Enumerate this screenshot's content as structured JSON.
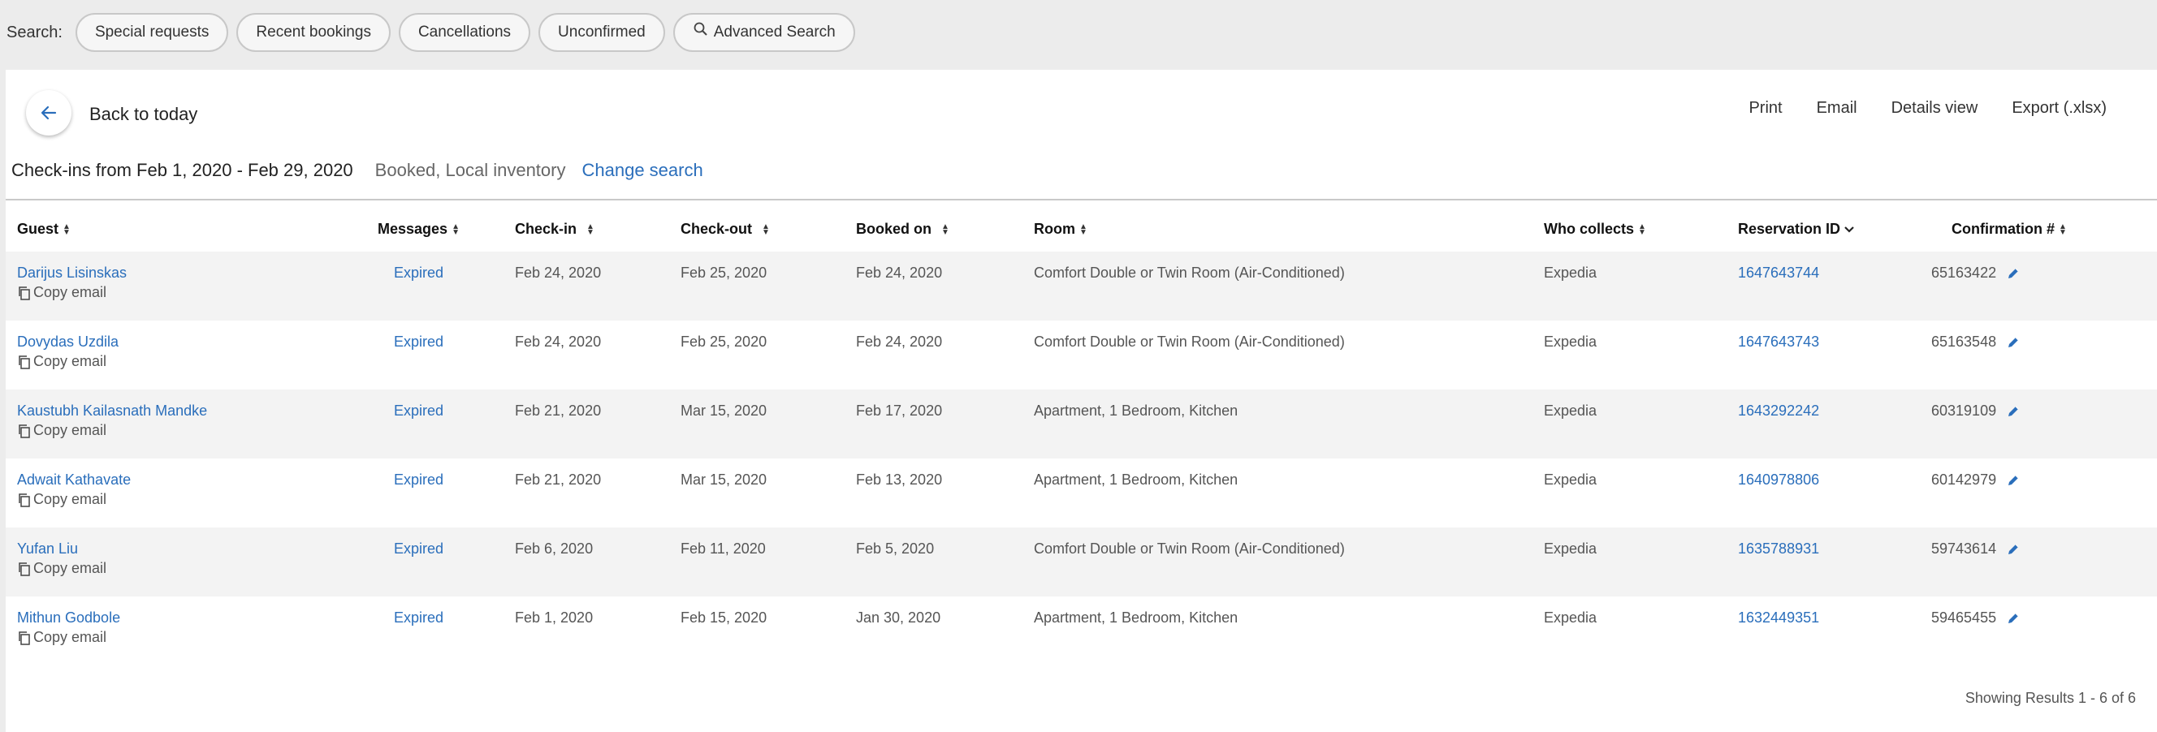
{
  "search": {
    "label": "Search:",
    "pills": [
      "Special requests",
      "Recent bookings",
      "Cancellations",
      "Unconfirmed",
      "Advanced Search"
    ]
  },
  "header": {
    "back_label": "Back to today",
    "actions": [
      "Print",
      "Email",
      "Details view",
      "Export (.xlsx)"
    ]
  },
  "filter": {
    "range": "Check-ins from Feb 1, 2020 - Feb 29, 2020",
    "filters": "Booked, Local inventory",
    "change": "Change search"
  },
  "table": {
    "columns": [
      "Guest",
      "Messages",
      "Check-in",
      "Check-out",
      "Booked on",
      "Room",
      "Who collects",
      "Reservation ID",
      "Confirmation #"
    ],
    "copy_label": "Copy email",
    "rows": [
      {
        "guest": "Darijus Lisinskas",
        "messages": "Expired",
        "checkin": "Feb 24, 2020",
        "checkout": "Feb 25, 2020",
        "booked": "Feb 24, 2020",
        "room": "Comfort Double or Twin Room (Air-Conditioned)",
        "collects": "Expedia",
        "reservation": "1647643744",
        "confirmation": "65163422"
      },
      {
        "guest": "Dovydas Uzdila",
        "messages": "Expired",
        "checkin": "Feb 24, 2020",
        "checkout": "Feb 25, 2020",
        "booked": "Feb 24, 2020",
        "room": "Comfort Double or Twin Room (Air-Conditioned)",
        "collects": "Expedia",
        "reservation": "1647643743",
        "confirmation": "65163548"
      },
      {
        "guest": "Kaustubh Kailasnath Mandke",
        "messages": "Expired",
        "checkin": "Feb 21, 2020",
        "checkout": "Mar 15, 2020",
        "booked": "Feb 17, 2020",
        "room": "Apartment, 1 Bedroom, Kitchen",
        "collects": "Expedia",
        "reservation": "1643292242",
        "confirmation": "60319109"
      },
      {
        "guest": "Adwait Kathavate",
        "messages": "Expired",
        "checkin": "Feb 21, 2020",
        "checkout": "Mar 15, 2020",
        "booked": "Feb 13, 2020",
        "room": "Apartment, 1 Bedroom, Kitchen",
        "collects": "Expedia",
        "reservation": "1640978806",
        "confirmation": "60142979"
      },
      {
        "guest": "Yufan Liu",
        "messages": "Expired",
        "checkin": "Feb 6, 2020",
        "checkout": "Feb 11, 2020",
        "booked": "Feb 5, 2020",
        "room": "Comfort Double or Twin Room (Air-Conditioned)",
        "collects": "Expedia",
        "reservation": "1635788931",
        "confirmation": "59743614"
      },
      {
        "guest": "Mithun Godbole",
        "messages": "Expired",
        "checkin": "Feb 1, 2020",
        "checkout": "Feb 15, 2020",
        "booked": "Jan 30, 2020",
        "room": "Apartment, 1 Bedroom, Kitchen",
        "collects": "Expedia",
        "reservation": "1632449351",
        "confirmation": "59465455"
      }
    ]
  },
  "footer": {
    "results": "Showing Results 1 - 6 of 6"
  },
  "colors": {
    "link": "#2a6ebb",
    "row_alt": "#f3f3f3",
    "page_bg": "#ececec"
  }
}
